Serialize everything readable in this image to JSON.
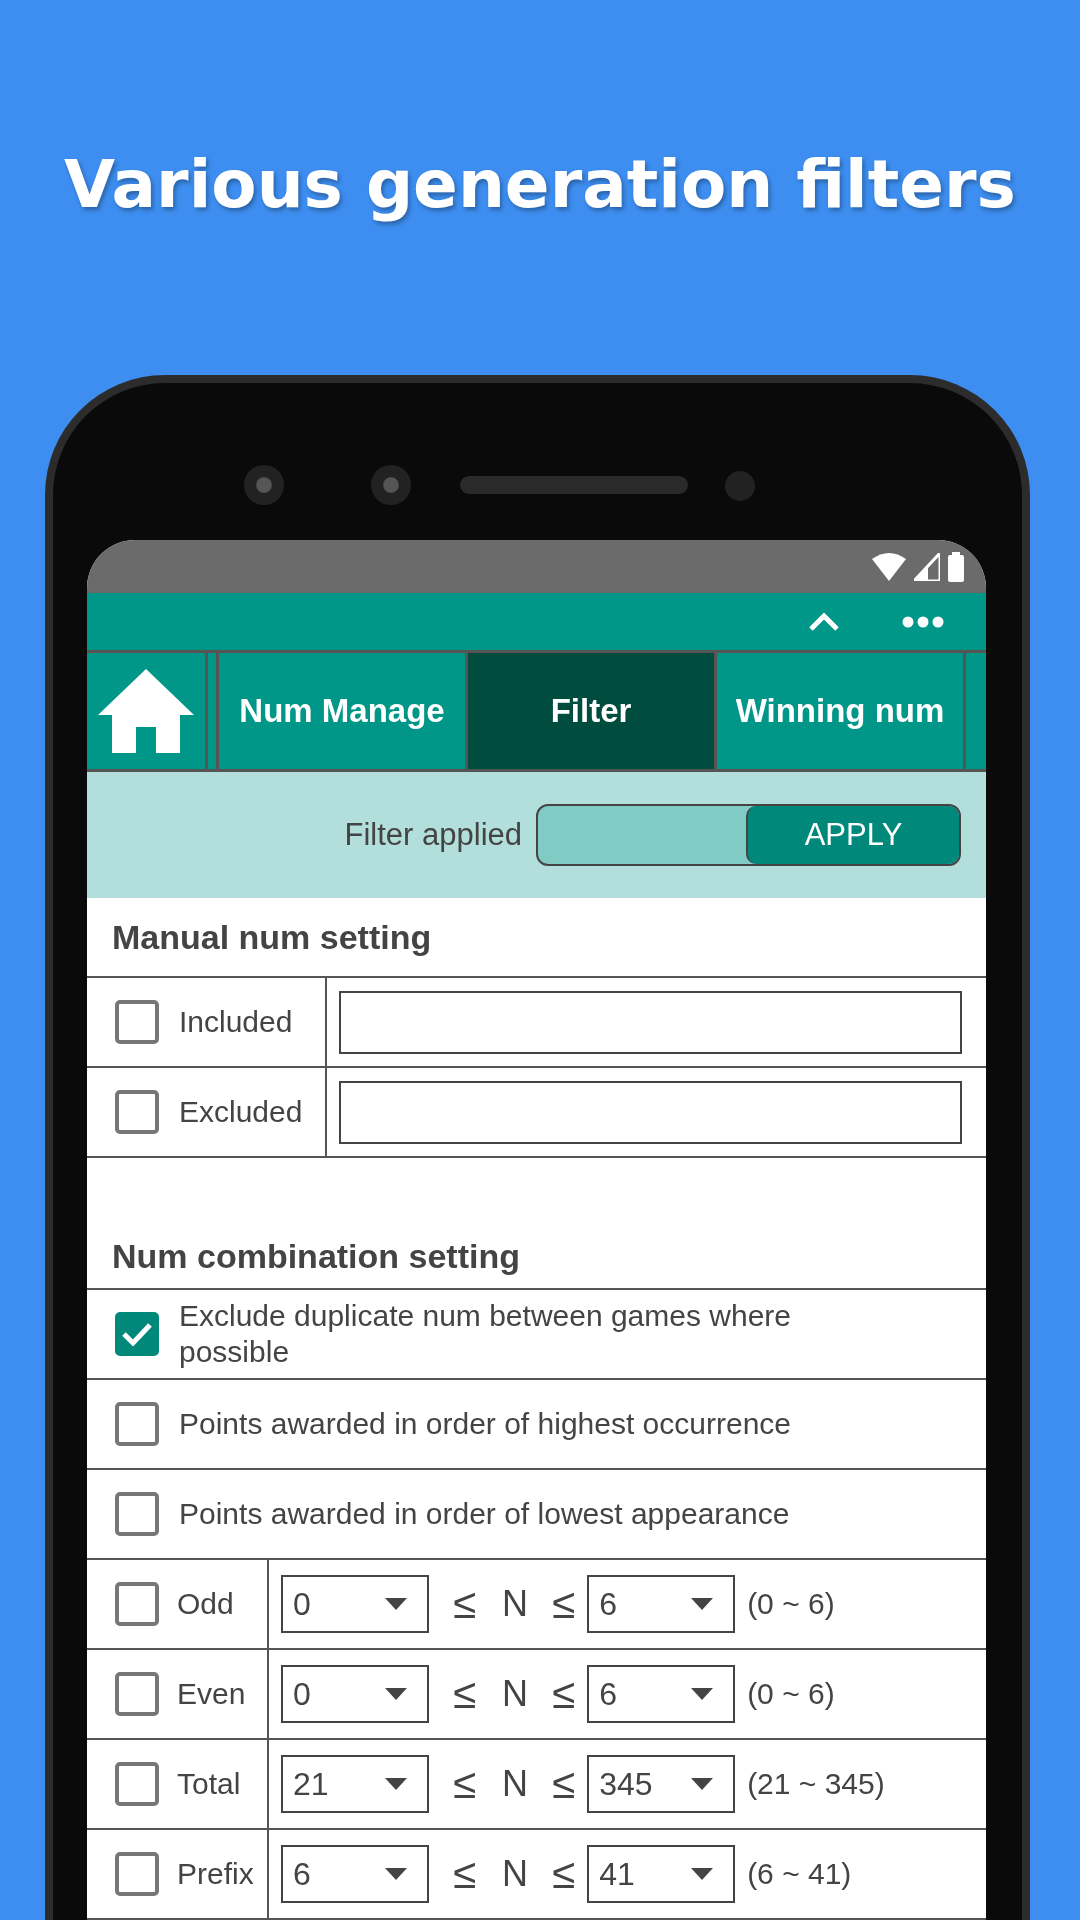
{
  "headline": "Various generation filters",
  "tabs": [
    {
      "kind": "icon",
      "selected": false
    },
    {
      "kind": "text",
      "label": "Num Manage",
      "selected": false
    },
    {
      "kind": "text",
      "label": "Filter",
      "selected": true
    },
    {
      "kind": "text",
      "label": "Winning num",
      "selected": false
    }
  ],
  "filter_bar": {
    "label": "Filter applied",
    "button": "APPLY"
  },
  "manual": {
    "title": "Manual num setting",
    "rows": [
      {
        "label": "Included",
        "checked": false
      },
      {
        "label": "Excluded",
        "checked": false
      }
    ]
  },
  "combination": {
    "title": "Num combination setting",
    "options": [
      {
        "label": "Exclude duplicate num between games where possible",
        "checked": true
      },
      {
        "label": "Points awarded in order of highest occurrence",
        "checked": false
      },
      {
        "label": "Points awarded in order of lowest appearance",
        "checked": false
      }
    ],
    "ranges": [
      {
        "label": "Odd",
        "checked": false,
        "min": "0",
        "op": "≤",
        "variable": "N",
        "max": "6",
        "range": "(0 ~ 6)"
      },
      {
        "label": "Even",
        "checked": false,
        "min": "0",
        "op": "≤",
        "variable": "N",
        "max": "6",
        "range": "(0 ~ 6)"
      },
      {
        "label": "Total",
        "checked": false,
        "min": "21",
        "op": "≤",
        "variable": "N",
        "max": "345",
        "range": "(21 ~ 345)"
      },
      {
        "label": "Prefix",
        "checked": false,
        "min": "6",
        "op": "≤",
        "variable": "N",
        "max": "41",
        "range": "(6 ~ 41)"
      }
    ]
  }
}
